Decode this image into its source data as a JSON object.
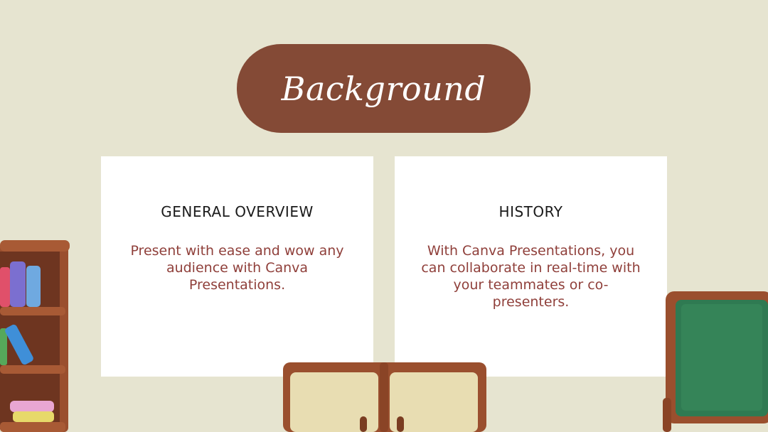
{
  "slide": {
    "title": "Background",
    "cards": [
      {
        "heading": "GENERAL OVERVIEW",
        "body": "Present with ease and wow any audience with Canva Presentations."
      },
      {
        "heading": "HISTORY",
        "body": "With Canva Presentations, you can collaborate in real-time with your teammates or co-presenters."
      }
    ]
  },
  "colors": {
    "background": "#e6e4d0",
    "title_pill": "#844a36",
    "card": "#ffffff",
    "heading": "#1a1a1a",
    "body_text": "#8f3f3a",
    "wood": "#9a4f2e",
    "chalkboard": "#2f7a52"
  },
  "icons": [
    "bookshelf-illustration",
    "sofa-illustration",
    "chalkboard-illustration"
  ]
}
